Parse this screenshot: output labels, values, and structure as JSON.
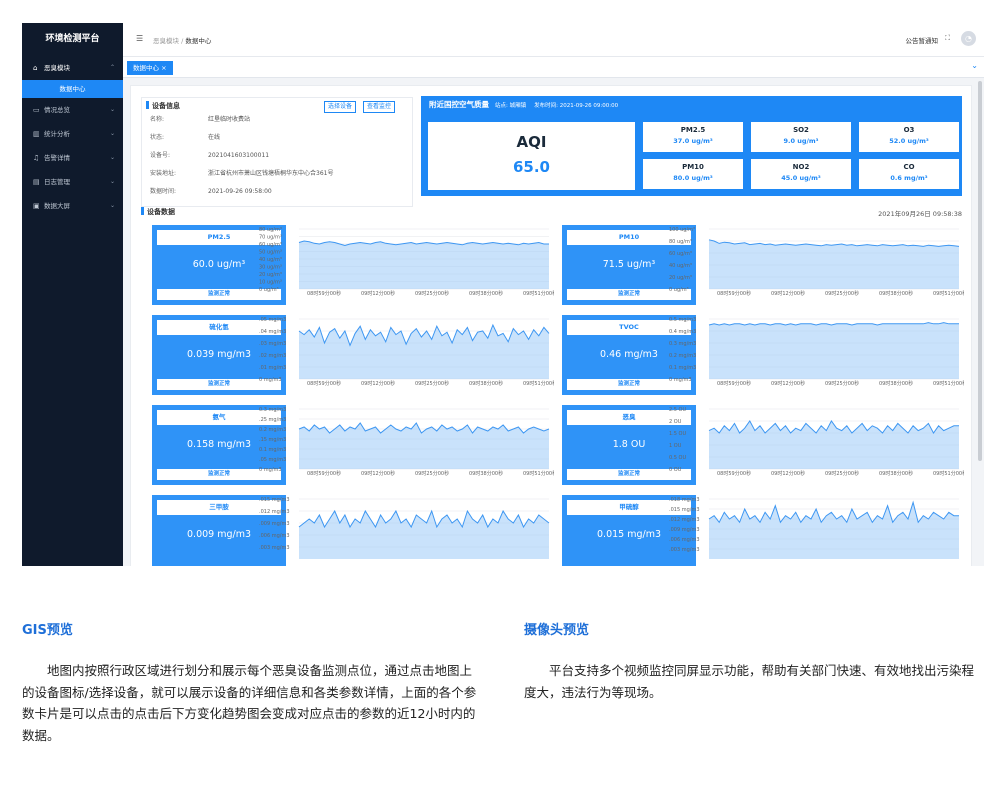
{
  "app": {
    "title": "环境检测平台"
  },
  "sidebar": {
    "items": [
      {
        "label": "恶臭模块",
        "icon": "home-icon",
        "open": true
      },
      {
        "label": "情况总览",
        "icon": "monitor-icon"
      },
      {
        "label": "统计分析",
        "icon": "bar-chart-icon"
      },
      {
        "label": "告警详情",
        "icon": "bell-icon"
      },
      {
        "label": "日志管理",
        "icon": "document-icon"
      },
      {
        "label": "数据大屏",
        "icon": "screen-icon"
      }
    ],
    "active_sub": "数据中心"
  },
  "header": {
    "breadcrumb_root": "恶臭模块",
    "breadcrumb_sep": "/",
    "breadcrumb_current": "数据中心",
    "notice": "公告暂通知",
    "fullscreen_glyph": "⛶",
    "avatar_glyph": "◔"
  },
  "tabs": [
    {
      "label": "数据中心 ×"
    }
  ],
  "device": {
    "title": "设备信息",
    "btn_select": "选择设备",
    "btn_monitor": "查看监控",
    "fields": [
      {
        "k": "名称:",
        "v": "红垦临时收费站"
      },
      {
        "k": "状态:",
        "v": "在线"
      },
      {
        "k": "设备号:",
        "v": "2021041603100011"
      },
      {
        "k": "安装地址:",
        "v": "浙江省杭州市萧山区钱塘梧桐华东中心合361号"
      },
      {
        "k": "数据时间:",
        "v": "2021-09-26 09:58:00"
      }
    ]
  },
  "aqi": {
    "header_title": "附近国控空气质量",
    "site": "站点: 城厢镇",
    "publish": "发布时间: 2021-09-26 09:00:00",
    "label": "AQI",
    "value": "65.0",
    "pollutants": [
      {
        "name": "PM2.5",
        "value": "37.0 ug/m³"
      },
      {
        "name": "SO2",
        "value": "9.0 ug/m³"
      },
      {
        "name": "O3",
        "value": "52.0 ug/m³"
      },
      {
        "name": "PM10",
        "value": "80.0 ug/m³"
      },
      {
        "name": "NO2",
        "value": "45.0 ug/m³"
      },
      {
        "name": "CO",
        "value": "0.6 mg/m³"
      }
    ]
  },
  "data_section": {
    "title": "设备数据",
    "time": "2021年09月26日 09:58:38"
  },
  "metrics": [
    {
      "name": "PM2.5",
      "value": "60.0 ug/m³",
      "status": "监测正常"
    },
    {
      "name": "PM10",
      "value": "71.5 ug/m³",
      "status": "监测正常"
    },
    {
      "name": "硫化氢",
      "value": "0.039 mg/m3",
      "status": "监测正常"
    },
    {
      "name": "TVOC",
      "value": "0.46 mg/m3",
      "status": "监测正常"
    },
    {
      "name": "氨气",
      "value": "0.158 mg/m3",
      "status": "监测正常"
    },
    {
      "name": "恶臭",
      "value": "1.8 OU",
      "status": "监测正常"
    },
    {
      "name": "三甲胺",
      "value": "0.009 mg/m3",
      "status": ""
    },
    {
      "name": "甲硫醇",
      "value": "0.015 mg/m3",
      "status": ""
    }
  ],
  "chart_data": [
    {
      "type": "area",
      "yticks": [
        "80 ug/m³",
        "70 ug/m³",
        "60 ug/m³",
        "50 ug/m³",
        "40 ug/m³",
        "30 ug/m³",
        "20 ug/m³",
        "10 ug/m³",
        "0 ug/m³"
      ],
      "ylim": [
        0,
        80
      ],
      "xticks": [
        "08时59分00秒",
        "09时12分00秒",
        "09时25分00秒",
        "09时38分00秒",
        "09时51分00秒"
      ],
      "values": [
        62,
        64,
        63,
        61,
        60,
        62,
        63,
        62,
        60,
        58,
        60,
        61,
        62,
        61,
        60,
        62,
        63,
        61,
        60,
        59,
        60,
        61,
        62,
        60,
        61,
        62,
        61,
        60,
        61,
        62,
        61,
        60,
        59,
        61,
        62,
        61,
        60,
        61,
        62,
        61,
        60,
        61,
        60,
        59,
        61,
        60,
        61,
        62,
        60,
        60
      ]
    },
    {
      "type": "area",
      "yticks": [
        "100 ug/m³",
        "80 ug/m³",
        "60 ug/m³",
        "40 ug/m³",
        "20 ug/m³",
        "0 ug/m³"
      ],
      "ylim": [
        0,
        100
      ],
      "xticks": [
        "08时59分00秒",
        "09时12分00秒",
        "09时25分00秒",
        "09时38分00秒",
        "09时51分00秒"
      ],
      "values": [
        82,
        80,
        76,
        78,
        77,
        75,
        76,
        77,
        74,
        75,
        76,
        74,
        75,
        73,
        74,
        75,
        74,
        73,
        74,
        75,
        74,
        73,
        72,
        74,
        73,
        74,
        75,
        73,
        74,
        72,
        73,
        74,
        73,
        72,
        74,
        73,
        72,
        73,
        74,
        72,
        73,
        72,
        71,
        73,
        72,
        71,
        72,
        73,
        72,
        71
      ]
    },
    {
      "type": "area",
      "yticks": [
        ".05 mg/m3",
        ".04 mg/m3",
        ".03 mg/m3",
        ".02 mg/m3",
        ".01 mg/m3",
        "0 mg/m3"
      ],
      "ylim": [
        0,
        0.05
      ],
      "xticks": [
        "08时59分00秒",
        "09时12分00秒",
        "09时25分00秒",
        "09时38分00秒",
        "09时51分00秒"
      ],
      "values": [
        0.04,
        0.037,
        0.041,
        0.035,
        0.043,
        0.03,
        0.039,
        0.042,
        0.034,
        0.04,
        0.028,
        0.038,
        0.044,
        0.033,
        0.041,
        0.036,
        0.039,
        0.031,
        0.043,
        0.037,
        0.04,
        0.029,
        0.038,
        0.042,
        0.035,
        0.04,
        0.033,
        0.044,
        0.036,
        0.039,
        0.03,
        0.041,
        0.037,
        0.043,
        0.032,
        0.039,
        0.04,
        0.034,
        0.045,
        0.036,
        0.038,
        0.031,
        0.042,
        0.037,
        0.04,
        0.033,
        0.041,
        0.036,
        0.043,
        0.038
      ]
    },
    {
      "type": "area",
      "yticks": [
        "0.5 mg/m3",
        "0.4 mg/m3",
        "0.3 mg/m3",
        "0.2 mg/m3",
        "0.1 mg/m3",
        "0 mg/m3"
      ],
      "ylim": [
        0,
        0.5
      ],
      "xticks": [
        "08时59分00秒",
        "09时12分00秒",
        "09时25分00秒",
        "09时38分00秒",
        "09时51分00秒"
      ],
      "values": [
        0.45,
        0.46,
        0.45,
        0.46,
        0.45,
        0.46,
        0.46,
        0.45,
        0.46,
        0.45,
        0.46,
        0.46,
        0.45,
        0.46,
        0.46,
        0.45,
        0.46,
        0.45,
        0.46,
        0.46,
        0.46,
        0.45,
        0.46,
        0.46,
        0.45,
        0.46,
        0.46,
        0.46,
        0.45,
        0.46,
        0.46,
        0.46,
        0.46,
        0.45,
        0.46,
        0.46,
        0.46,
        0.46,
        0.46,
        0.46,
        0.46,
        0.46,
        0.46,
        0.47,
        0.46,
        0.46,
        0.47,
        0.46,
        0.46,
        0.46
      ]
    },
    {
      "type": "area",
      "yticks": [
        "0.3 mg/m3",
        ".25 mg/m3",
        "0.2 mg/m3",
        ".15 mg/m3",
        "0.1 mg/m3",
        ".05 mg/m3",
        "0 mg/m3"
      ],
      "ylim": [
        0,
        0.3
      ],
      "xticks": [
        "08时59分00秒",
        "09时12分00秒",
        "09时25分00秒",
        "09时38分00秒",
        "09时51分00秒"
      ],
      "values": [
        0.2,
        0.21,
        0.19,
        0.22,
        0.2,
        0.21,
        0.18,
        0.2,
        0.22,
        0.19,
        0.21,
        0.2,
        0.23,
        0.19,
        0.2,
        0.21,
        0.18,
        0.2,
        0.22,
        0.2,
        0.19,
        0.21,
        0.2,
        0.23,
        0.18,
        0.2,
        0.21,
        0.19,
        0.22,
        0.2,
        0.21,
        0.19,
        0.2,
        0.22,
        0.18,
        0.21,
        0.2,
        0.19,
        0.21,
        0.2,
        0.22,
        0.19,
        0.2,
        0.21,
        0.18,
        0.2,
        0.21,
        0.2,
        0.19,
        0.2
      ]
    },
    {
      "type": "area",
      "yticks": [
        "2.5 OU",
        "2 OU",
        "1.5 OU",
        "1 OU",
        "0.5 OU",
        "0 OU"
      ],
      "ylim": [
        0,
        2.5
      ],
      "xticks": [
        "08时59分00秒",
        "09时12分00秒",
        "09时25分00秒",
        "09时38分00秒",
        "09时51分00秒"
      ],
      "values": [
        1.6,
        1.7,
        1.5,
        1.8,
        1.6,
        1.9,
        1.5,
        1.7,
        2.0,
        1.6,
        1.8,
        1.5,
        1.7,
        1.9,
        1.6,
        1.8,
        1.5,
        1.7,
        1.6,
        1.9,
        1.7,
        1.5,
        1.8,
        1.6,
        2.0,
        1.7,
        1.6,
        1.8,
        1.5,
        1.7,
        1.9,
        1.6,
        1.8,
        1.7,
        1.5,
        1.8,
        1.6,
        1.9,
        1.7,
        1.5,
        1.8,
        1.6,
        1.7,
        1.9,
        1.5,
        1.8,
        1.6,
        1.7,
        1.8,
        1.8
      ]
    },
    {
      "type": "area",
      "yticks": [
        ".015 mg/m3",
        ".012 mg/m3",
        ".009 mg/m3",
        ".006 mg/m3",
        ".003 mg/m3"
      ],
      "ylim": [
        0,
        0.015
      ],
      "xticks": [],
      "values": [
        0.008,
        0.009,
        0.01,
        0.009,
        0.011,
        0.008,
        0.01,
        0.012,
        0.009,
        0.011,
        0.008,
        0.01,
        0.009,
        0.012,
        0.01,
        0.008,
        0.011,
        0.009,
        0.01,
        0.012,
        0.009,
        0.01,
        0.008,
        0.011,
        0.01,
        0.009,
        0.012,
        0.008,
        0.01,
        0.011,
        0.009,
        0.01,
        0.008,
        0.012,
        0.01,
        0.009,
        0.011,
        0.008,
        0.01,
        0.009,
        0.012,
        0.01,
        0.009,
        0.011,
        0.008,
        0.01,
        0.009,
        0.011,
        0.01,
        0.009
      ]
    },
    {
      "type": "area",
      "yticks": [
        ".018 mg/m3",
        ".015 mg/m3",
        ".012 mg/m3",
        ".009 mg/m3",
        ".006 mg/m3",
        ".003 mg/m3"
      ],
      "ylim": [
        0,
        0.018
      ],
      "xticks": [],
      "values": [
        0.012,
        0.013,
        0.011,
        0.014,
        0.012,
        0.013,
        0.011,
        0.015,
        0.012,
        0.013,
        0.011,
        0.014,
        0.012,
        0.016,
        0.011,
        0.013,
        0.012,
        0.014,
        0.011,
        0.013,
        0.012,
        0.015,
        0.011,
        0.013,
        0.014,
        0.012,
        0.013,
        0.011,
        0.015,
        0.012,
        0.013,
        0.014,
        0.011,
        0.013,
        0.012,
        0.016,
        0.011,
        0.013,
        0.014,
        0.012,
        0.017,
        0.011,
        0.013,
        0.012,
        0.014,
        0.013,
        0.012,
        0.014,
        0.013,
        0.013
      ]
    }
  ],
  "bottom": {
    "left_title": "GIS预览",
    "left_text": "地图内按照行政区域进行划分和展示每个恶臭设备监测点位，通过点击地图上的设备图标/选择设备，就可以展示设备的详细信息和各类参数详情，上面的各个参数卡片是可以点击的点击后下方变化趋势图会变成对应点击的参数的近12小时内的数据。",
    "right_title": "摄像头预览",
    "right_text": "平台支持多个视频监控同屏显示功能，帮助有关部门快速、有效地找出污染程度大，违法行为等现场。"
  },
  "colors": {
    "accent": "#1e88f5",
    "sidebar_bg": "#0f1a2c",
    "heading": "#1e6fd8"
  }
}
